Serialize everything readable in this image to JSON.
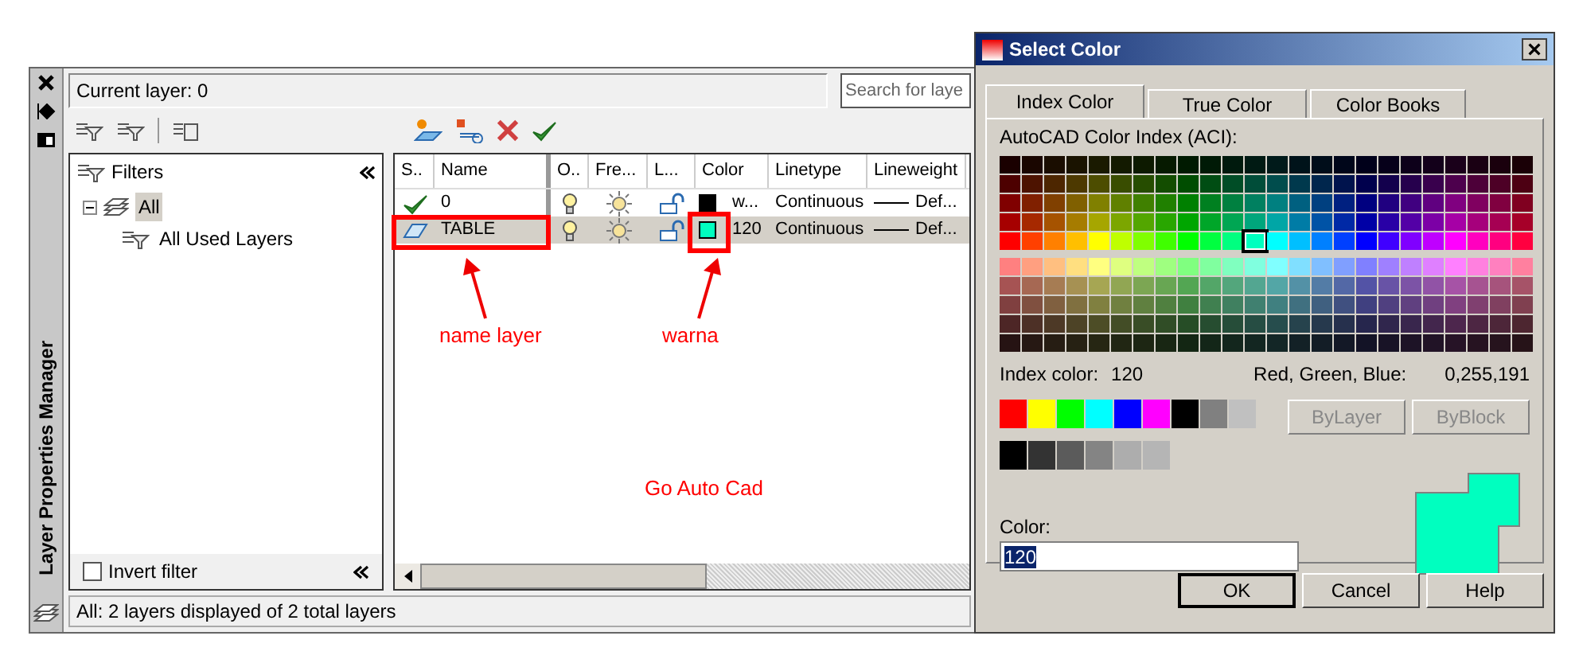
{
  "layer_manager": {
    "title": "Layer Properties Manager",
    "current_layer": "Current layer: 0",
    "search": {
      "placeholder": "Search for laye"
    },
    "filters": {
      "title": "Filters",
      "tree": [
        {
          "label": "All",
          "expanded": true,
          "selected": true,
          "children": [
            {
              "label": "All Used Layers",
              "selected": false
            }
          ]
        }
      ],
      "invert_filter": {
        "label": "Invert filter",
        "checked": false
      }
    },
    "columns": [
      "S..",
      "Name",
      "O..",
      "Fre...",
      "L...",
      "Color",
      "Linetype",
      "Lineweight"
    ],
    "layers": [
      {
        "current": true,
        "name": "0",
        "on": true,
        "frozen": false,
        "locked": false,
        "color": "#000000",
        "color_name": "w...",
        "linetype": "Continuous",
        "lineweight": "Def...",
        "selected": false
      },
      {
        "current": false,
        "name": "TABLE",
        "on": true,
        "frozen": false,
        "locked": false,
        "color": "#00ffbf",
        "color_name": "120",
        "linetype": "Continuous",
        "lineweight": "Def...",
        "selected": true
      }
    ],
    "status": "All: 2 layers displayed of 2 total layers",
    "annotations": [
      {
        "text": "name layer"
      },
      {
        "text": "warna"
      },
      {
        "text": "Go Auto Cad"
      }
    ]
  },
  "dialog": {
    "title": "Select Color",
    "tabs": [
      {
        "label": "Index Color",
        "selected": true
      },
      {
        "label": "True Color",
        "selected": false
      },
      {
        "label": "Color Books",
        "selected": false
      }
    ],
    "palette_label": "AutoCAD Color Index (ACI):",
    "index_label": "Index color:",
    "index_value": "120",
    "rgb_label": "Red, Green, Blue:",
    "rgb_value": "0,255,191",
    "standard_colors": [
      {
        "color": "#ff0000"
      },
      {
        "color": "#ffff00"
      },
      {
        "color": "#00ff00"
      },
      {
        "color": "#00ffff"
      },
      {
        "color": "#0000ff"
      },
      {
        "color": "#ff00ff"
      },
      {
        "color": "#000000"
      },
      {
        "color": "#808080"
      },
      {
        "color": "#c0c0c0"
      }
    ],
    "gray_colors": [
      {
        "color": "#000000"
      },
      {
        "color": "#333333"
      },
      {
        "color": "#5b5b5b"
      },
      {
        "color": "#848484"
      },
      {
        "color": "#adadad"
      },
      {
        "color": "#b5b5b5"
      }
    ],
    "by_buttons": [
      {
        "label": "ByLayer",
        "disabled": true
      },
      {
        "label": "ByBlock",
        "disabled": true
      }
    ],
    "color_label": "Color:",
    "color_value": "120",
    "buttons": [
      {
        "label": "OK",
        "default": true
      },
      {
        "label": "Cancel",
        "default": false
      },
      {
        "label": "Help",
        "default": false
      }
    ]
  }
}
